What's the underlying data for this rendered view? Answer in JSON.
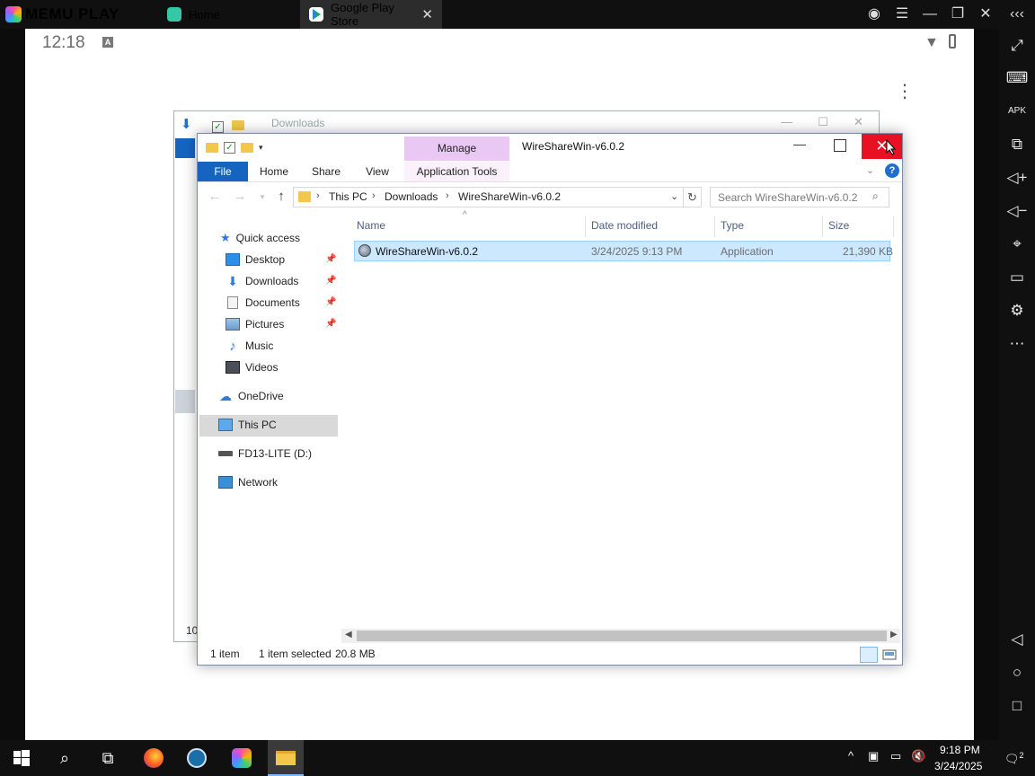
{
  "memu": {
    "brand": "MEMU PLAY",
    "tabs": [
      {
        "label": "Home",
        "active": false
      },
      {
        "label": "Google Play Store",
        "active": true
      }
    ],
    "top_controls": [
      "account-icon",
      "menu-icon",
      "minimize-icon",
      "restore-icon",
      "close-icon",
      "collapse-icon"
    ],
    "sidebar": [
      "fullscreen-icon",
      "keyboard-icon",
      "apk-icon",
      "multi-instance-icon",
      "volume-up-icon",
      "volume-down-icon",
      "location-icon",
      "folder-icon",
      "settings-icon",
      "more-icon",
      "back-icon",
      "home-icon",
      "recents-icon"
    ]
  },
  "android": {
    "time": "12:18",
    "status_icon": "A"
  },
  "back_window": {
    "title": "Downloads",
    "footer_text": "10"
  },
  "explorer": {
    "title": "WireShareWin-v6.0.2",
    "contextual_tab": "Manage",
    "ribbon_tabs": {
      "file": "File",
      "home": "Home",
      "share": "Share",
      "view": "View",
      "app_tools": "Application Tools"
    },
    "breadcrumb": [
      "This PC",
      "Downloads",
      "WireShareWin-v6.0.2"
    ],
    "search_placeholder": "Search WireShareWin-v6.0.2",
    "nav": {
      "quick_access": "Quick access",
      "desktop": "Desktop",
      "downloads": "Downloads",
      "documents": "Documents",
      "pictures": "Pictures",
      "music": "Music",
      "videos": "Videos",
      "onedrive": "OneDrive",
      "this_pc": "This PC",
      "drive": "FD13-LITE (D:)",
      "network": "Network"
    },
    "columns": {
      "name": "Name",
      "date": "Date modified",
      "type": "Type",
      "size": "Size"
    },
    "files": [
      {
        "name": "WireShareWin-v6.0.2",
        "date": "3/24/2025 9:13 PM",
        "type": "Application",
        "size": "21,390 KB"
      }
    ],
    "status": {
      "count": "1 item",
      "selected": "1 item selected",
      "size": "20.8 MB"
    }
  },
  "taskbar": {
    "time": "9:18 PM",
    "date": "3/24/2025",
    "notifications": "2"
  },
  "colors": {
    "accent": "#1565c0",
    "close_red": "#e81123",
    "selection": "#cce8ff",
    "manage_tab": "#e9c8f3"
  }
}
